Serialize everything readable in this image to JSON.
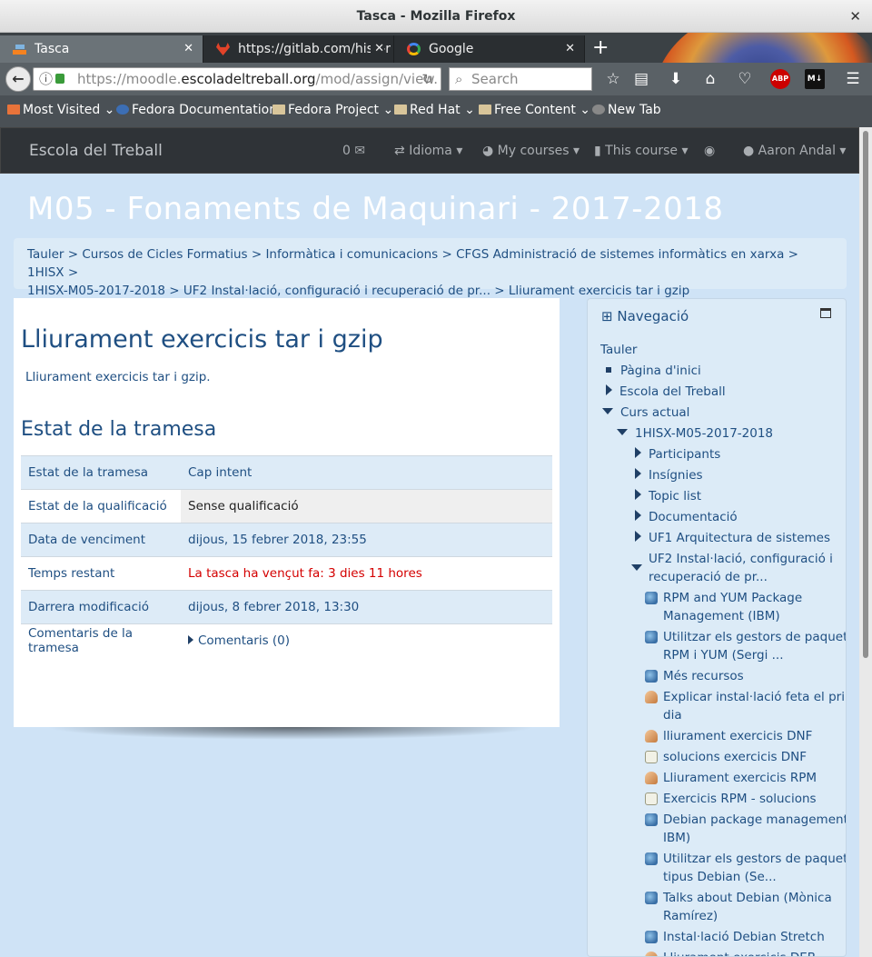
{
  "window": {
    "title": "Tasca - Mozilla Firefox",
    "close": "✕"
  },
  "tabs": [
    {
      "label": "Tasca",
      "close": "✕"
    },
    {
      "label": "https://gitlab.com/hisx-r",
      "close": "✕"
    },
    {
      "label": "Google",
      "close": "✕"
    }
  ],
  "newtab": "+",
  "address": {
    "prefix": "https://moodle.",
    "domain": "escoladeltreball.org",
    "path": "/mod/assign/view.",
    "reload": "↻"
  },
  "search": {
    "placeholder": "Search"
  },
  "bookmarks": [
    "Most Visited",
    "Fedora Documentation",
    "Fedora Project",
    "Red Hat",
    "Free Content",
    "New Tab"
  ],
  "moodle_nav": {
    "brand": "Escola del Treball",
    "messages": "0 ✉",
    "language": "Idioma",
    "my_courses": "My courses",
    "this_course": "This course",
    "user": "Aaron Andal"
  },
  "page_title": "M05 - Fonaments de Maquinari - 2017-2018",
  "breadcrumb": {
    "line1": "Tauler > Cursos de Cicles Formatius > Informàtica i comunicacions > CFGS Administració de sistemes informàtics en xarxa > 1HISX >",
    "line2": "1HISX-M05-2017-2018 > UF2 Instal·lació, configuració i recuperació de pr... > Lliurament exercicis tar i gzip"
  },
  "main": {
    "heading": "Lliurament exercicis tar i gzip",
    "intro": "Lliurament exercicis tar i gzip.",
    "status_heading": "Estat de la tramesa",
    "rows": [
      {
        "label": "Estat de la tramesa",
        "value": "Cap intent"
      },
      {
        "label": "Estat de la qualificació",
        "value": "Sense qualificació"
      },
      {
        "label": "Data de venciment",
        "value": "dijous, 15 febrer 2018, 23:55"
      },
      {
        "label": "Temps restant",
        "value": "La tasca ha vençut fa: 3 dies 11 hores"
      },
      {
        "label": "Darrera modificació",
        "value": "dijous, 8 febrer 2018, 13:30"
      },
      {
        "label": "Comentaris de la tramesa",
        "value": "Comentaris (0)"
      }
    ]
  },
  "navigation": {
    "title": "Navegació",
    "items": {
      "tauler": "Tauler",
      "inici": "Pàgina d'inici",
      "escola": "Escola del Treball",
      "curs_actual": "Curs actual",
      "course": "1HISX-M05-2017-2018",
      "participants": "Participants",
      "insignies": "Insígnies",
      "topic": "Topic list",
      "documentacio": "Documentació",
      "uf1": "UF1 Arquitectura de sistemes",
      "uf2_1": "UF2 Instal·lació, configuració i",
      "uf2_2": "recuperació de pr...",
      "r1_1": "RPM and YUM Package",
      "r1_2": "Management (IBM)",
      "r2_1": "Utilitzar els gestors de paquets",
      "r2_2": "RPM i YUM (Sergi ...",
      "r3": "Més recursos",
      "r4_1": "Explicar instal·lació feta el primer",
      "r4_2": "dia",
      "r5": "lliurament exercicis DNF",
      "r6": "solucions exercicis DNF",
      "r7": "Lliurament exercicis RPM",
      "r8": "Exercicis RPM - solucions",
      "r9_1": "Debian package management (LPI",
      "r9_2": "IBM)",
      "r10_1": "Utilitzar els gestors de paquets",
      "r10_2": "tipus Debian (Se...",
      "r11_1": "Talks about Debian (Mònica",
      "r11_2": "Ramírez)",
      "r12": "Instal·lació Debian Stretch",
      "r13": "Lliurament exercicis DEB"
    }
  },
  "colors": {
    "page_bg": "#cfe3f6",
    "text": "#1f4f82",
    "overdue": "#d40000",
    "navbar": "#2f3337"
  }
}
